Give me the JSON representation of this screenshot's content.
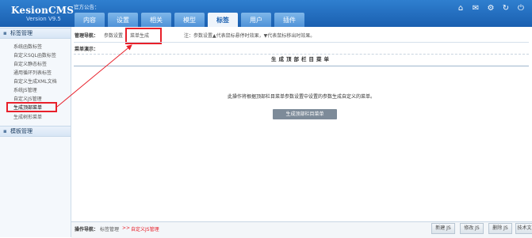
{
  "header": {
    "logo_name": "KesionCMS",
    "logo_version": "Version V9.5",
    "notice_label": "官方公告：",
    "tabs": [
      {
        "label": "内容"
      },
      {
        "label": "设置"
      },
      {
        "label": "相关"
      },
      {
        "label": "模型"
      },
      {
        "label": "标签"
      },
      {
        "label": "用户"
      },
      {
        "label": "插件"
      }
    ],
    "active_tab": "标签",
    "icons": [
      "home-icon",
      "mail-icon",
      "tools-icon",
      "refresh-icon",
      "power-icon"
    ]
  },
  "sidebar": {
    "section1": "标签管理",
    "items": [
      {
        "label": "系统函数标签"
      },
      {
        "label": "自定义SQL函数标签"
      },
      {
        "label": "自定义静态标签"
      },
      {
        "label": "通用循环列表标签"
      },
      {
        "label": "自定义生成XML文档"
      },
      {
        "label": "系统JS管理"
      },
      {
        "label": "自定义JS管理"
      },
      {
        "label": "生成顶部菜单"
      },
      {
        "label": "生成树形菜单"
      }
    ],
    "active_item": "生成顶部菜单",
    "section2": "模板管理"
  },
  "main": {
    "admin_nav_label": "管理导航：",
    "link_params": "参数设置",
    "link_generate": "菜单生成",
    "note": "注：参数设置▲代表鼠标悬停时效果，▼代表鼠标移出时效果。",
    "demo_label": "菜单演示：",
    "panel_title": "生成顶部栏目菜单",
    "description": "此操作将根据顶部栏目菜单参数设置中设置的参数生成自定义的菜单。",
    "generate_button": "生成顶部栏目菜单"
  },
  "bottom": {
    "op_label": "操作导航：",
    "op_tag": "标签管理",
    "op_sep": ">>",
    "op_current": "自定义JS管理",
    "buttons": [
      "新建 JS",
      "修改 JS",
      "删除 JS",
      "技术文"
    ]
  },
  "colors": {
    "header_blue": "#1a5fb0",
    "highlight_red": "#e8202a"
  }
}
